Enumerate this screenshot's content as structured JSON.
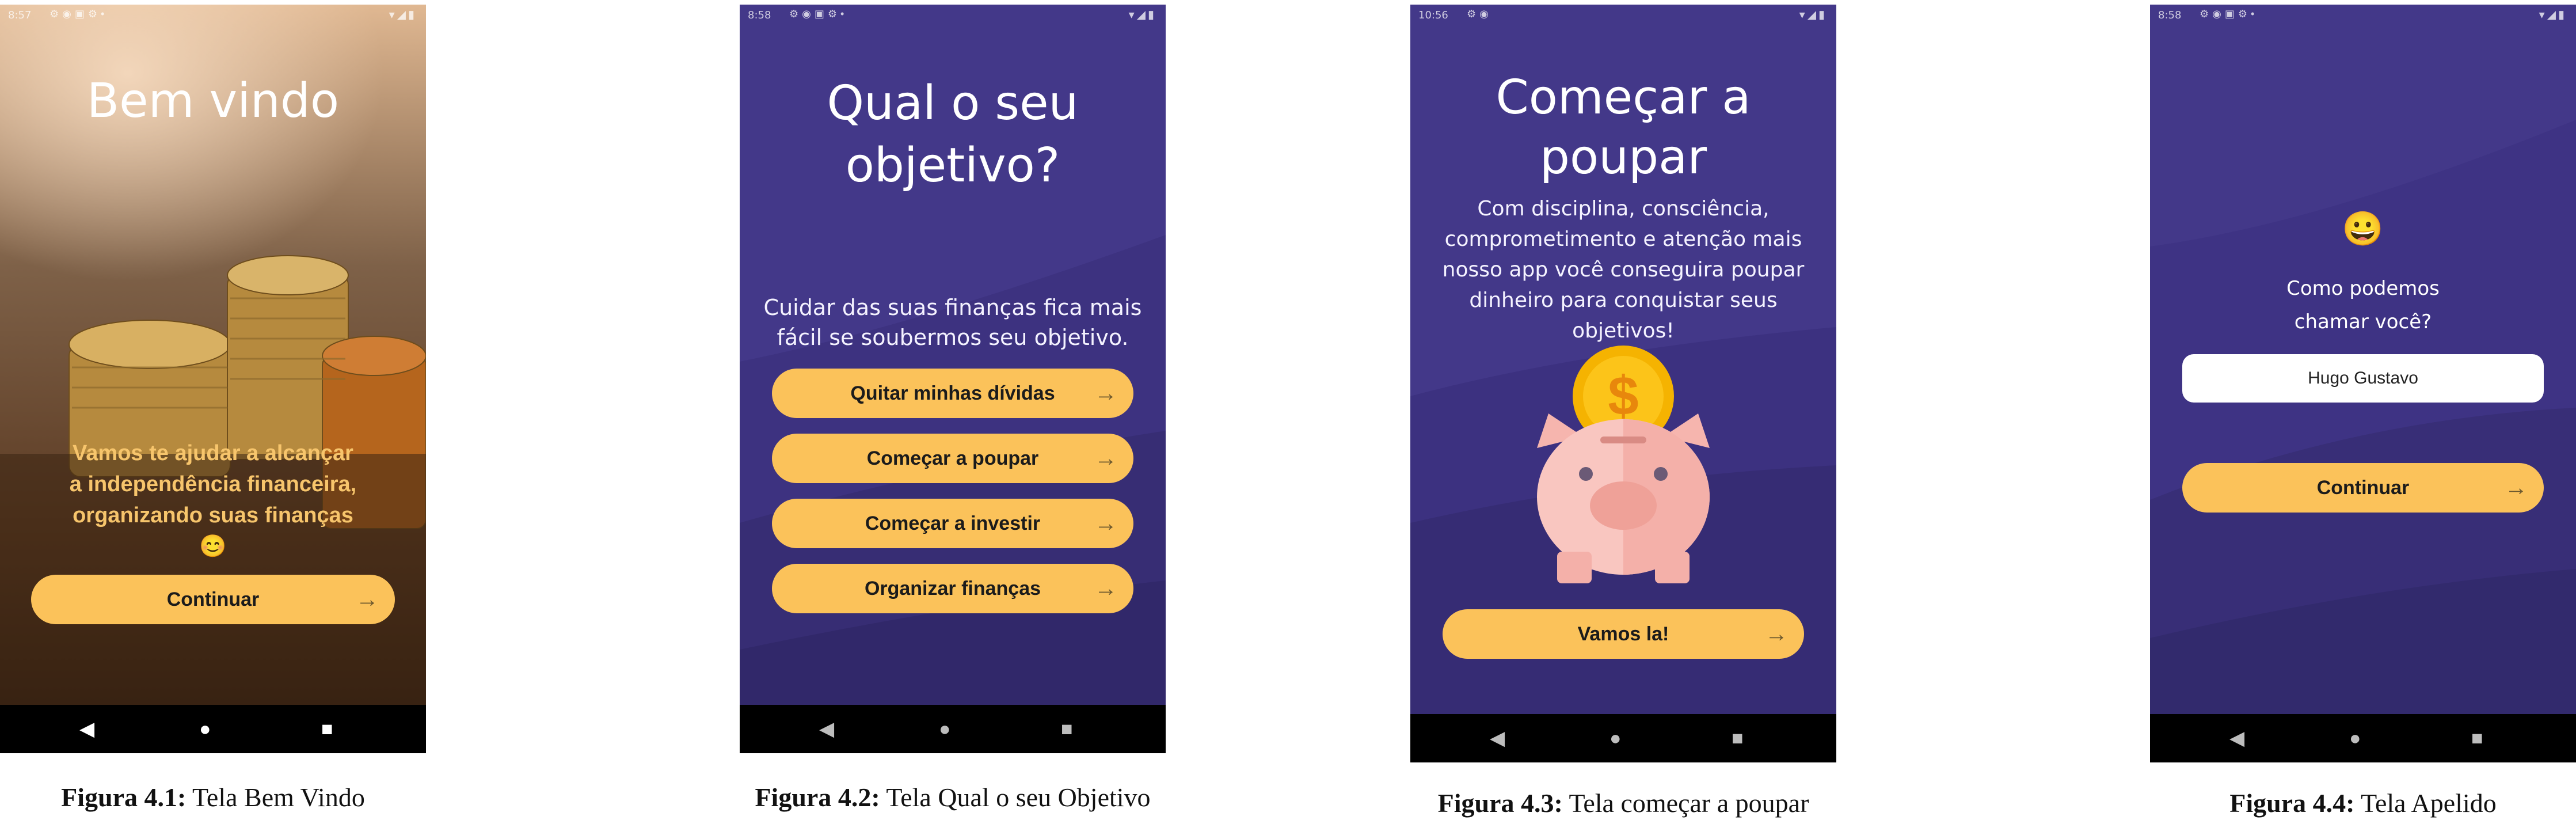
{
  "status": {
    "screen1_time": "8:57",
    "screen2_time": "8:58",
    "screen3_time": "10:56",
    "screen4_time": "8:58"
  },
  "nav": {
    "back": "◀",
    "home": "●",
    "recent": "■"
  },
  "screen1": {
    "title": "Bem vindo",
    "message_lines": [
      "Vamos te ajudar a alcançar",
      "a independência financeira,",
      "organizando suas finanças"
    ],
    "emoji": "😊",
    "button_label": "Continuar",
    "caption_label": "Figura 4.1:",
    "caption_text": "Tela Bem Vindo"
  },
  "screen2": {
    "title_lines": [
      "Qual o seu",
      "objetivo?"
    ],
    "subtitle_lines": [
      "Cuidar das suas finanças fica mais",
      "fácil se soubermos seu objetivo."
    ],
    "options": [
      "Quitar minhas dívidas",
      "Começar a poupar",
      "Começar a investir",
      "Organizar finanças"
    ],
    "caption_label": "Figura 4.2:",
    "caption_text": "Tela Qual o seu Objetivo"
  },
  "screen3": {
    "title_lines": [
      "Começar a",
      "poupar"
    ],
    "body_lines": [
      "Com disciplina, consciência,",
      "comprometimento e atenção mais",
      "nosso app você conseguira poupar",
      "dinheiro para conquistar seus",
      "objetivos!"
    ],
    "coin_symbol": "$",
    "button_label": "Vamos la!",
    "caption_label": "Figura 4.3:",
    "caption_text": "Tela começar a poupar"
  },
  "screen4": {
    "emoji": "😀",
    "question_lines": [
      "Como podemos",
      "chamar você?"
    ],
    "input_value": "Hugo Gustavo",
    "button_label": "Continuar",
    "caption_label": "Figura 4.4:",
    "caption_text": "Tela Apelido"
  },
  "colors": {
    "accent": "#fbc25a",
    "purple": "#403587",
    "navbar": "#000000"
  }
}
